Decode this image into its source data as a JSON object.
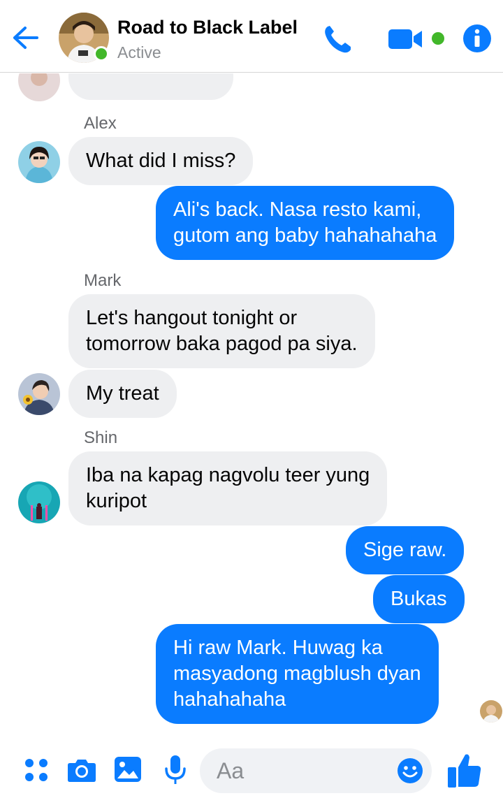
{
  "header": {
    "title": "Road to Black Label",
    "status": "Active",
    "icons": [
      "back-arrow-icon",
      "phone-icon",
      "video-camera-icon",
      "info-icon"
    ],
    "accent_color": "#0a7cff",
    "online_color": "#42b72a"
  },
  "messages": [
    {
      "sender": "Alex",
      "direction": "incoming",
      "text": "What did I miss?"
    },
    {
      "sender": "me",
      "direction": "outgoing",
      "lines": [
        "Ali's back. Nasa resto kami,",
        "gutom ang baby hahahahaha"
      ]
    },
    {
      "sender": "Mark",
      "direction": "incoming",
      "lines": [
        "Let's hangout tonight or",
        "tomorrow baka pagod pa siya."
      ]
    },
    {
      "sender": "Mark",
      "direction": "incoming",
      "text": "My treat"
    },
    {
      "sender": "Shin",
      "direction": "incoming",
      "lines": [
        "Iba na kapag nagvolu teer yung",
        "kuripot"
      ]
    },
    {
      "sender": "me",
      "direction": "outgoing",
      "text": "Sige raw."
    },
    {
      "sender": "me",
      "direction": "outgoing",
      "text": "Bukas"
    },
    {
      "sender": "me",
      "direction": "outgoing",
      "lines": [
        "Hi raw Mark. Huwag ka",
        "masyadong magblush dyan",
        "hahahahaha"
      ]
    }
  ],
  "composer": {
    "placeholder": "Aa",
    "icons": [
      "apps-icon",
      "camera-icon",
      "gallery-icon",
      "microphone-icon",
      "emoji-icon",
      "thumbs-up-icon"
    ]
  },
  "colors": {
    "incoming_bubble": "#eeeff1",
    "outgoing_bubble": "#0a7cff"
  }
}
